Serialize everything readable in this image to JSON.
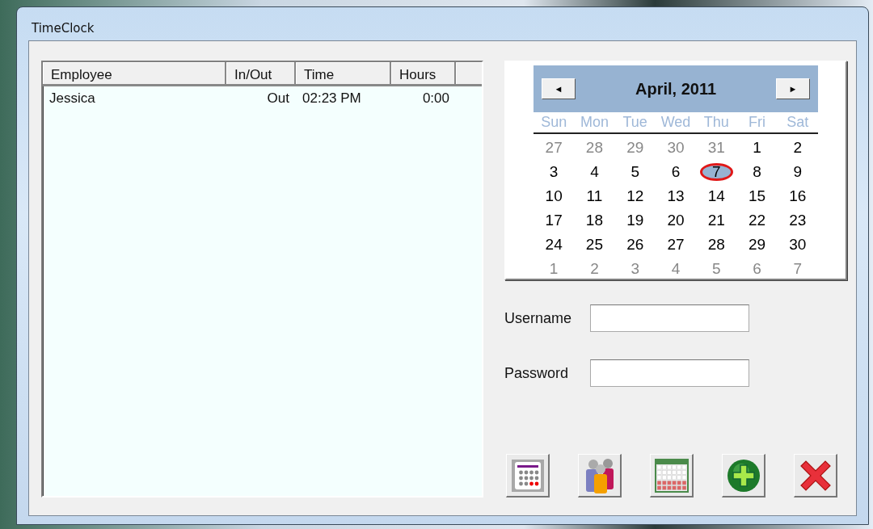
{
  "window": {
    "title": "TimeClock"
  },
  "table": {
    "columns": [
      "Employee",
      "In/Out",
      "Time",
      "Hours"
    ],
    "rows": [
      {
        "employee": "Jessica",
        "in_out": "Out",
        "time": "02:23 PM",
        "hours": "0:00"
      }
    ]
  },
  "calendar": {
    "title": "April, 2011",
    "prev": "◄",
    "next": "►",
    "weekdays": [
      "Sun",
      "Mon",
      "Tue",
      "Wed",
      "Thu",
      "Fri",
      "Sat"
    ],
    "weeks": [
      [
        {
          "day": "27",
          "in_month": false,
          "selected": false
        },
        {
          "day": "28",
          "in_month": false,
          "selected": false
        },
        {
          "day": "29",
          "in_month": false,
          "selected": false
        },
        {
          "day": "30",
          "in_month": false,
          "selected": false
        },
        {
          "day": "31",
          "in_month": false,
          "selected": false
        },
        {
          "day": "1",
          "in_month": true,
          "selected": false
        },
        {
          "day": "2",
          "in_month": true,
          "selected": false
        }
      ],
      [
        {
          "day": "3",
          "in_month": true,
          "selected": false
        },
        {
          "day": "4",
          "in_month": true,
          "selected": false
        },
        {
          "day": "5",
          "in_month": true,
          "selected": false
        },
        {
          "day": "6",
          "in_month": true,
          "selected": false
        },
        {
          "day": "7",
          "in_month": true,
          "selected": true
        },
        {
          "day": "8",
          "in_month": true,
          "selected": false
        },
        {
          "day": "9",
          "in_month": true,
          "selected": false
        }
      ],
      [
        {
          "day": "10",
          "in_month": true,
          "selected": false
        },
        {
          "day": "11",
          "in_month": true,
          "selected": false
        },
        {
          "day": "12",
          "in_month": true,
          "selected": false
        },
        {
          "day": "13",
          "in_month": true,
          "selected": false
        },
        {
          "day": "14",
          "in_month": true,
          "selected": false
        },
        {
          "day": "15",
          "in_month": true,
          "selected": false
        },
        {
          "day": "16",
          "in_month": true,
          "selected": false
        }
      ],
      [
        {
          "day": "17",
          "in_month": true,
          "selected": false
        },
        {
          "day": "18",
          "in_month": true,
          "selected": false
        },
        {
          "day": "19",
          "in_month": true,
          "selected": false
        },
        {
          "day": "20",
          "in_month": true,
          "selected": false
        },
        {
          "day": "21",
          "in_month": true,
          "selected": false
        },
        {
          "day": "22",
          "in_month": true,
          "selected": false
        },
        {
          "day": "23",
          "in_month": true,
          "selected": false
        }
      ],
      [
        {
          "day": "24",
          "in_month": true,
          "selected": false
        },
        {
          "day": "25",
          "in_month": true,
          "selected": false
        },
        {
          "day": "26",
          "in_month": true,
          "selected": false
        },
        {
          "day": "27",
          "in_month": true,
          "selected": false
        },
        {
          "day": "28",
          "in_month": true,
          "selected": false
        },
        {
          "day": "29",
          "in_month": true,
          "selected": false
        },
        {
          "day": "30",
          "in_month": true,
          "selected": false
        }
      ],
      [
        {
          "day": "1",
          "in_month": false,
          "selected": false
        },
        {
          "day": "2",
          "in_month": false,
          "selected": false
        },
        {
          "day": "3",
          "in_month": false,
          "selected": false
        },
        {
          "day": "4",
          "in_month": false,
          "selected": false
        },
        {
          "day": "5",
          "in_month": false,
          "selected": false
        },
        {
          "day": "6",
          "in_month": false,
          "selected": false
        },
        {
          "day": "7",
          "in_month": false,
          "selected": false
        }
      ]
    ]
  },
  "login": {
    "username_label": "Username",
    "password_label": "Password"
  },
  "toolbar": [
    {
      "kind": "schedule"
    },
    {
      "kind": "employees"
    },
    {
      "kind": "month"
    },
    {
      "kind": "add"
    },
    {
      "kind": "close"
    }
  ]
}
